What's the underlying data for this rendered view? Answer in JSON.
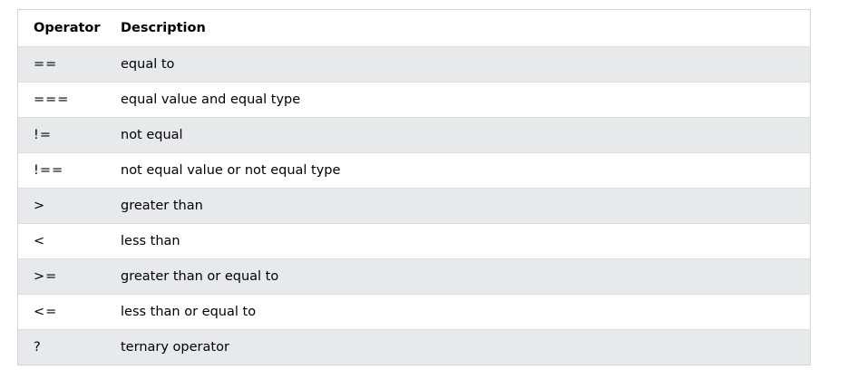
{
  "headers": {
    "operator": "Operator",
    "description": "Description"
  },
  "rows": [
    {
      "operator": "==",
      "description": "equal to"
    },
    {
      "operator": "===",
      "description": "equal value and equal type"
    },
    {
      "operator": "!=",
      "description": "not equal"
    },
    {
      "operator": "!==",
      "description": "not equal value or not equal type"
    },
    {
      "operator": ">",
      "description": "greater than"
    },
    {
      "operator": "<",
      "description": "less than"
    },
    {
      "operator": ">=",
      "description": "greater than or equal to"
    },
    {
      "operator": "<=",
      "description": "less than or equal to"
    },
    {
      "operator": "?",
      "description": "ternary operator"
    }
  ],
  "colors": {
    "stripe": "#e7e9eb",
    "border": "#d4d4d4"
  }
}
